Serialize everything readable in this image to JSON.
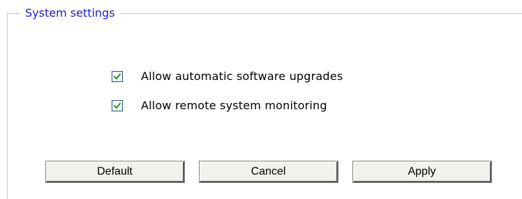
{
  "settings_group": {
    "title": "System settings",
    "options": [
      {
        "label": "Allow automatic software upgrades",
        "checked": true
      },
      {
        "label": "Allow remote system monitoring",
        "checked": true
      }
    ]
  },
  "buttons": {
    "default_label": "Default",
    "cancel_label": "Cancel",
    "apply_label": "Apply"
  },
  "colors": {
    "legend_text": "#1a1ad6",
    "checkbox_border": "#1c5180",
    "checkmark": "#21a121",
    "frame_line": "#c4c4c4",
    "button_face": "#f1f1ee"
  }
}
